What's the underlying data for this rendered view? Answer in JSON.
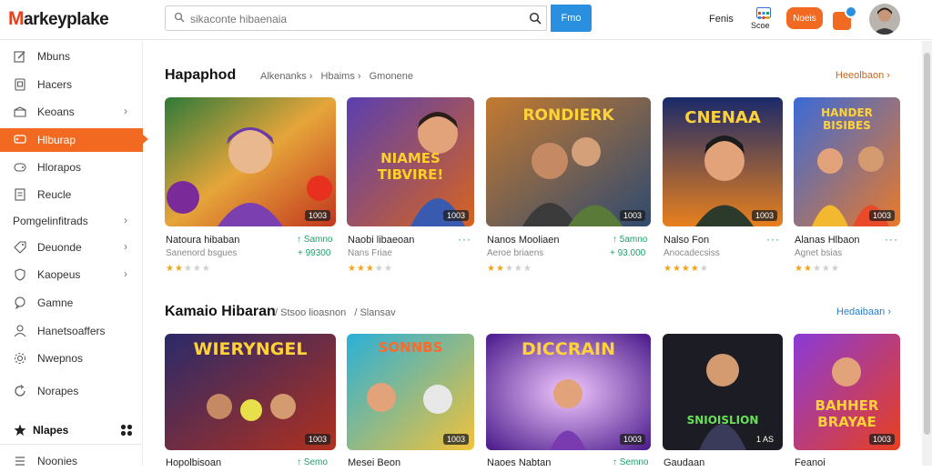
{
  "brand": {
    "logo_first": "M",
    "logo_rest": "arkeyplake"
  },
  "search": {
    "value": "",
    "placeholder": "sikaconte hibaenaia",
    "button": "Fmo"
  },
  "topbar": {
    "link": "Fenis",
    "grid_label": "Scoe",
    "pill_button": "Noeis",
    "accent": "#f26a21",
    "blue": "#2a8fde"
  },
  "sidebar": {
    "items": [
      {
        "label": "Mbuns",
        "icon": "edit-icon"
      },
      {
        "label": "Hacers",
        "icon": "bookmark-icon"
      },
      {
        "label": "Keoans",
        "icon": "box-icon",
        "chevron": "›"
      },
      {
        "label": "Hlburap",
        "icon": "gamepad-icon",
        "active": true
      },
      {
        "label": "Hlorapos",
        "icon": "controller-icon"
      },
      {
        "label": "Reucle",
        "icon": "file-icon"
      },
      {
        "label": "Pomgelinfitrads",
        "plain": true,
        "chevron": "›"
      },
      {
        "label": "Deuonde",
        "icon": "tag-icon",
        "chevron": "›"
      },
      {
        "label": "Kaopeus",
        "icon": "shield-icon",
        "chevron": "›"
      },
      {
        "label": "Gamne",
        "icon": "chat-icon"
      },
      {
        "label": "Hanetsoaffers",
        "icon": "person-icon"
      },
      {
        "label": "Nwepnos",
        "icon": "settings-icon"
      },
      {
        "label": "Norapes",
        "icon": "sync-icon"
      },
      {
        "label": "Nlapes",
        "icon": "puzzle-icon",
        "section": true
      },
      {
        "label": "Noonies",
        "icon": "list-icon"
      }
    ]
  },
  "sections": [
    {
      "title": "Hapaphod",
      "crumbs": [
        "Alkenanks ›",
        "Hbaims ›",
        "Gmonene"
      ],
      "see_all": "Heeolbaon ›",
      "see_all_color": "#c8661c",
      "cards": [
        {
          "title": "Natoura hibaban",
          "sub": "Sanenord bsgues",
          "price1": "↑ Samno",
          "price2": "+ 99300",
          "stars": 2,
          "tag": "1003",
          "art": "",
          "more": false
        },
        {
          "title": "Naobi libaeoan",
          "sub": "Nans Friae",
          "stars": 3,
          "tag": "1003",
          "art": "NIAMES TIBVIRE!",
          "more": true
        },
        {
          "title": "Nanos Mooliaen",
          "sub": "Aeroe briaens",
          "price1": "↑ 5amno",
          "price2": "+ 93.000",
          "stars": 2,
          "tag": "1003",
          "art": "RONDIERK",
          "more": false
        },
        {
          "title": "Nalso Fon",
          "sub": "Anocadecsiss",
          "stars": 4,
          "tag": "1003",
          "art": "CNENAA",
          "more": true
        },
        {
          "title": "Alanas Hlbaon",
          "sub": "Agnet bsias",
          "stars": 2,
          "tag": "1003",
          "art": "HANDER BISIBES",
          "more": true
        }
      ]
    },
    {
      "title": "Kamaio Hibaran",
      "crumbs": [
        "/ Stsoo lioasnon",
        "/ Slansav"
      ],
      "see_all": "Hedaibaan ›",
      "see_all_color": "#2a7fc8",
      "cards": [
        {
          "title": "Hopolbisoan",
          "sub": "",
          "price1": "↑ Semo",
          "stars": 0,
          "tag": "1003",
          "art": "WIERYNGEL",
          "more": false
        },
        {
          "title": "Mesei Beon",
          "sub": "",
          "stars": 0,
          "tag": "1003",
          "art": "SONNBS",
          "more": false
        },
        {
          "title": "Naoes Nabtan",
          "sub": "",
          "price1": "↑ Semno",
          "stars": 0,
          "tag": "1003",
          "art": "DICCRAIN",
          "more": false
        },
        {
          "title": "Gaudaan",
          "sub": "",
          "stars": 0,
          "tag": "1 AS",
          "art": "SNIOISLION",
          "more": false
        },
        {
          "title": "Feanoi",
          "sub": "",
          "stars": 0,
          "tag": "1003",
          "art": "BAHHER BRAYAE",
          "more": false
        }
      ]
    }
  ]
}
